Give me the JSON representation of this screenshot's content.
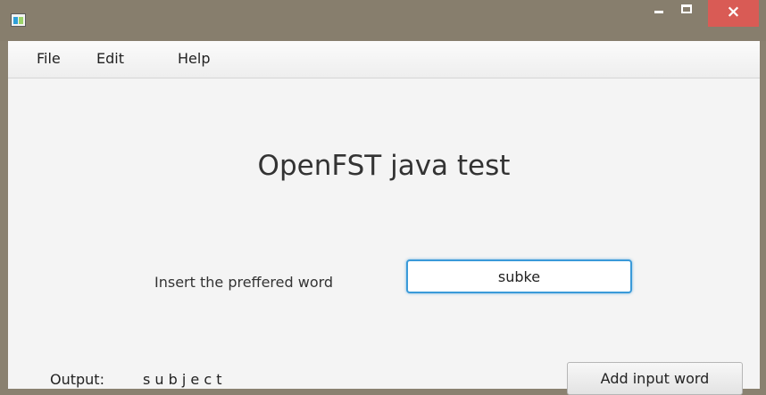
{
  "menu": {
    "items": [
      {
        "label": "File"
      },
      {
        "label": "Edit"
      },
      {
        "label": "Help"
      }
    ]
  },
  "window": {
    "close_symbol": "×",
    "icons": {
      "app": "app-icon",
      "minimize": "minimize-icon",
      "maximize": "maximize-icon",
      "close": "close-icon"
    },
    "close_color": "#d95b55"
  },
  "main": {
    "title": "OpenFST java test",
    "input": {
      "label": "Insert the preffered word",
      "value": "subke"
    },
    "output": {
      "label": "Output:",
      "value": "s u b j e c t"
    },
    "add_button_label": "Add input word"
  },
  "colors": {
    "input_focus_border": "#3a9ad9",
    "window_background": "#f4f4f4"
  }
}
